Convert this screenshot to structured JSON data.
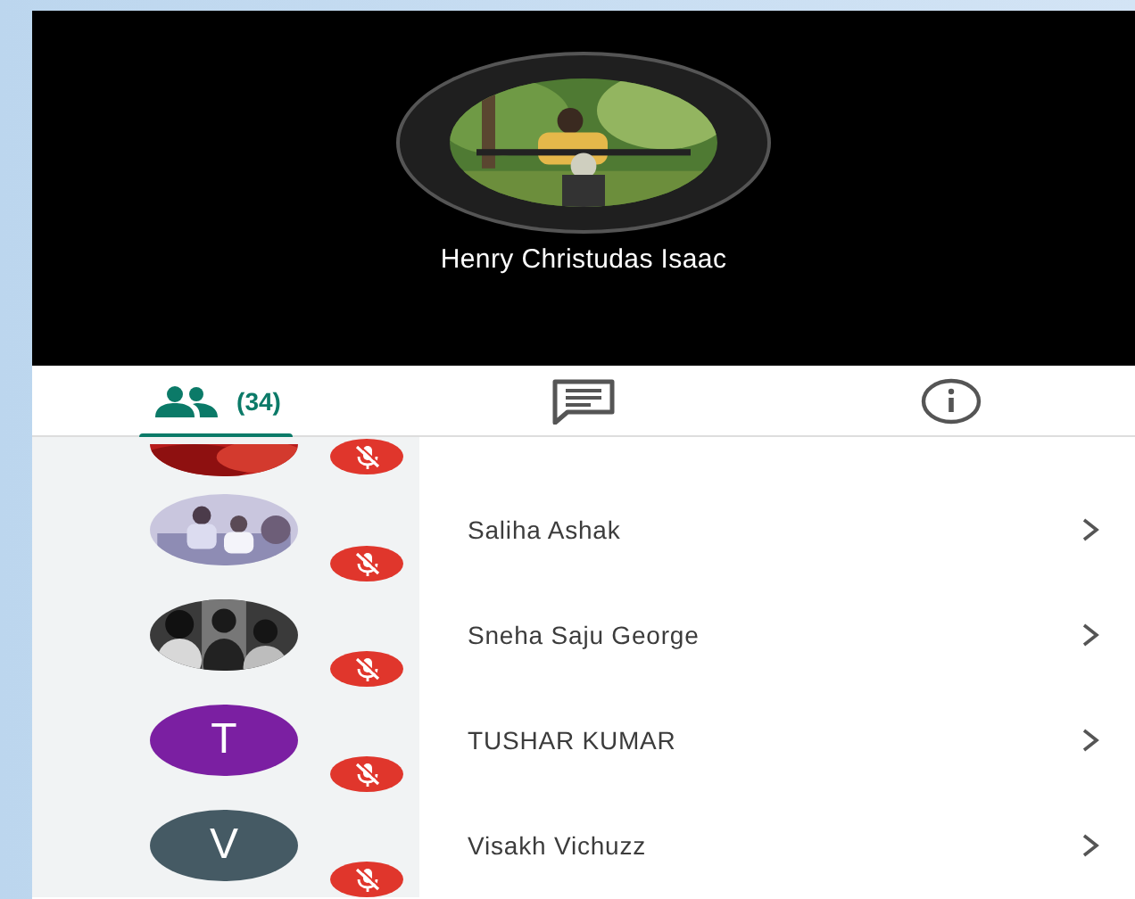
{
  "call_header": {
    "name": "Henry Christudas Isaac"
  },
  "tabs": [
    {
      "kind": "people",
      "label": "(34)",
      "selected": true
    },
    {
      "kind": "chat",
      "selected": false
    },
    {
      "kind": "info",
      "selected": false
    }
  ],
  "participants": [
    {
      "muted": true
    },
    {
      "name": "Saliha Ashak",
      "muted": true
    },
    {
      "name": "Sneha Saju George",
      "muted": true
    },
    {
      "avatar": {
        "kind": "letter",
        "letter": "T",
        "color": "#7b1fa2"
      },
      "name": "TUSHAR KUMAR",
      "muted": true
    },
    {
      "avatar": {
        "kind": "letter",
        "letter": "V",
        "color": "#455a64"
      },
      "name": "Visakh Vichuzz",
      "muted": true
    }
  ]
}
